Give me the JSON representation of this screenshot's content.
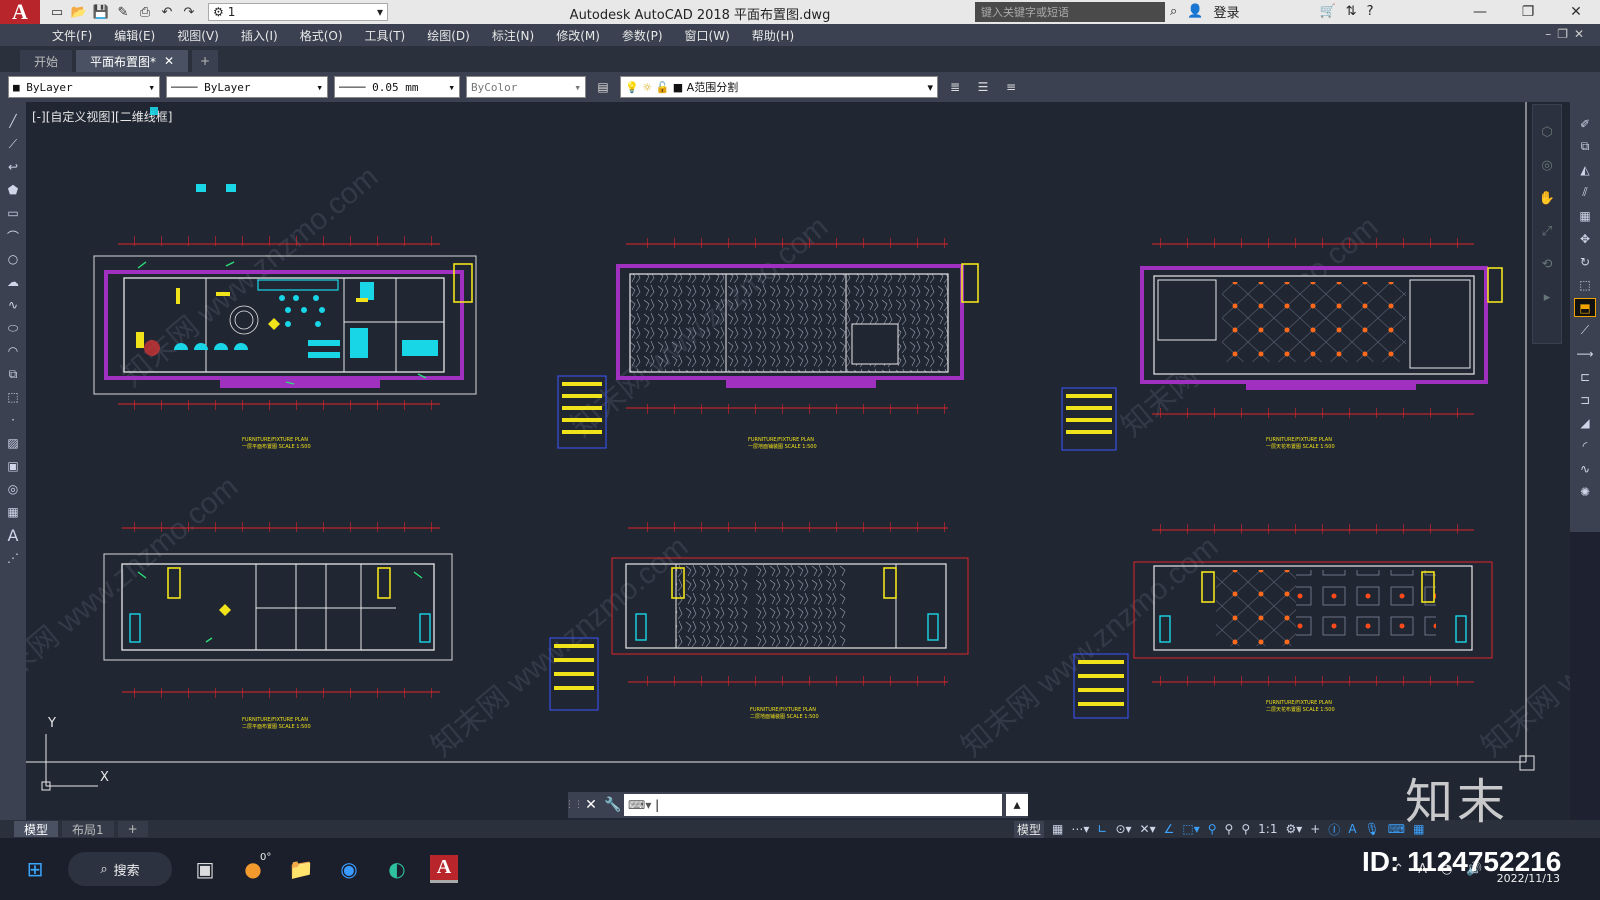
{
  "titlebar": {
    "workspace": "1",
    "title": "Autodesk AutoCAD 2018    平面布置图.dwg",
    "search_placeholder": "键入关键字或短语",
    "login": "登录"
  },
  "menu": [
    "文件(F)",
    "编辑(E)",
    "视图(V)",
    "插入(I)",
    "格式(O)",
    "工具(T)",
    "绘图(D)",
    "标注(N)",
    "修改(M)",
    "参数(P)",
    "窗口(W)",
    "帮助(H)"
  ],
  "tabs": {
    "start": "开始",
    "active": "平面布置图*"
  },
  "properties": {
    "color": "ByLayer",
    "linetype": "ByLayer",
    "lineweight": "0.05 mm",
    "plotstyle": "ByColor",
    "layer": "A范围分割"
  },
  "canvas": {
    "view_label": "[-][自定义视图][二维线框]",
    "plans": [
      {
        "title": "FURNITURE/FIXTURE PLAN",
        "subtitle": "一层平面布置图 SCALE 1:500"
      },
      {
        "title": "FURNITURE/FIXTURE PLAN",
        "subtitle": "一层地面铺装图 SCALE 1:500"
      },
      {
        "title": "FURNITURE/FIXTURE PLAN",
        "subtitle": "一层天花布置图 SCALE 1:500"
      },
      {
        "title": "FURNITURE/FIXTURE PLAN",
        "subtitle": "二层平面布置图 SCALE 1:500"
      },
      {
        "title": "FURNITURE/FIXTURE PLAN",
        "subtitle": "二层地面铺装图 SCALE 1:500"
      },
      {
        "title": "FURNITURE/FIXTURE PLAN",
        "subtitle": "二层天花布置图 SCALE 1:500"
      }
    ],
    "watermark": "知末网 www.znzmo.com",
    "ucs_y": "Y",
    "ucs_x": "X"
  },
  "layout_tabs": {
    "model": "模型",
    "layout1": "布局1"
  },
  "status": {
    "model": "模型",
    "scale": "1:1"
  },
  "taskbar": {
    "search": "搜索",
    "temp": "0°",
    "date": "2022/11/13"
  },
  "brand": {
    "logo_text": "知末",
    "id_text": "ID: 1124752216"
  },
  "colors": {
    "canvas_bg": "#212633",
    "dim_red": "#e0242a",
    "wall_purple": "#a030c0",
    "cyan": "#19d6e6",
    "yellow": "#f1e31a",
    "white": "#e8e8e8"
  }
}
